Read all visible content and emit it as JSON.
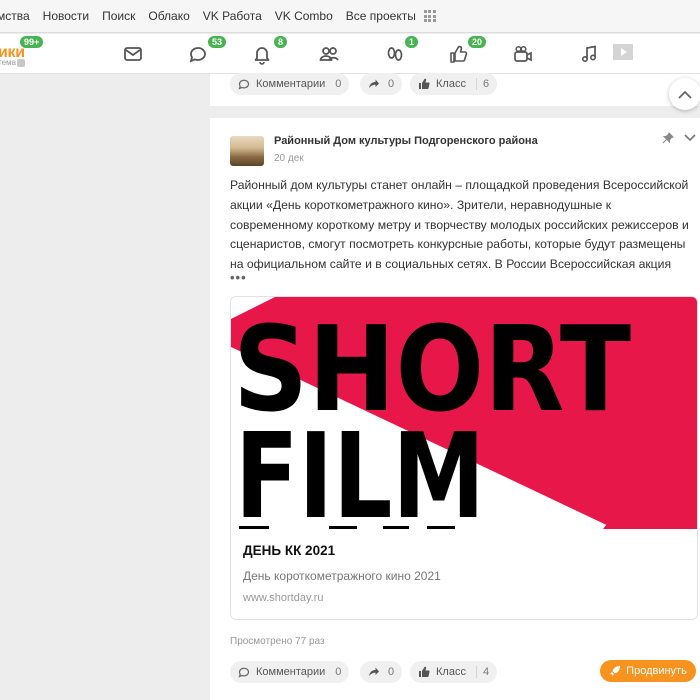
{
  "topbar": {
    "items": [
      "мства",
      "Новости",
      "Поиск",
      "Облако",
      "VK Работа",
      "VK Combo",
      "Все проекты"
    ]
  },
  "toolbar": {
    "logo_text": "ики",
    "logo_sub": "тема",
    "badges": {
      "profile": "99+",
      "discussions": "53",
      "notifications": "8",
      "guests": "1",
      "events": "20"
    },
    "icons": [
      "messages-icon",
      "discussions-icon",
      "notifications-icon",
      "friends-icon",
      "guests-icon",
      "events-icon",
      "video-icon",
      "music-icon"
    ]
  },
  "top_post": {
    "comments_label": "Комментарии",
    "comments_count": "0",
    "shares_count": "0",
    "likes_label": "Класс",
    "likes_count": "6"
  },
  "post": {
    "author": "Районный Дом культуры Подгоренского района",
    "date": "20 дек",
    "text_lines": [
      "Районный дом культуры станет онлайн – площадкой проведения Всероссийской",
      "акции «День короткометражного кино». Зрители, неравнодушные к",
      "современному короткому метру и творчеству молодых российских режиссеров и",
      "сценаристов, смогут посмотреть конкурсные работы, которые будут размещены",
      "на официальном сайте и в социальных сетях. В России Всероссийская акция"
    ],
    "more": "•••",
    "card": {
      "image_text_1": "SHORT",
      "image_text_2": "FILM",
      "title": "ДЕНЬ КК 2021",
      "description": "День короткометражного кино 2021",
      "url": "www.shortday.ru"
    },
    "views": "Просмотрено 77 раз",
    "comments_label": "Комментарии",
    "comments_count": "0",
    "shares_count": "0",
    "likes_label": "Класс",
    "likes_count": "4",
    "promote_label": "Продвинуть"
  },
  "colors": {
    "accent": "#f7931e",
    "badge": "#46b450",
    "film_red": "#e8174a"
  }
}
